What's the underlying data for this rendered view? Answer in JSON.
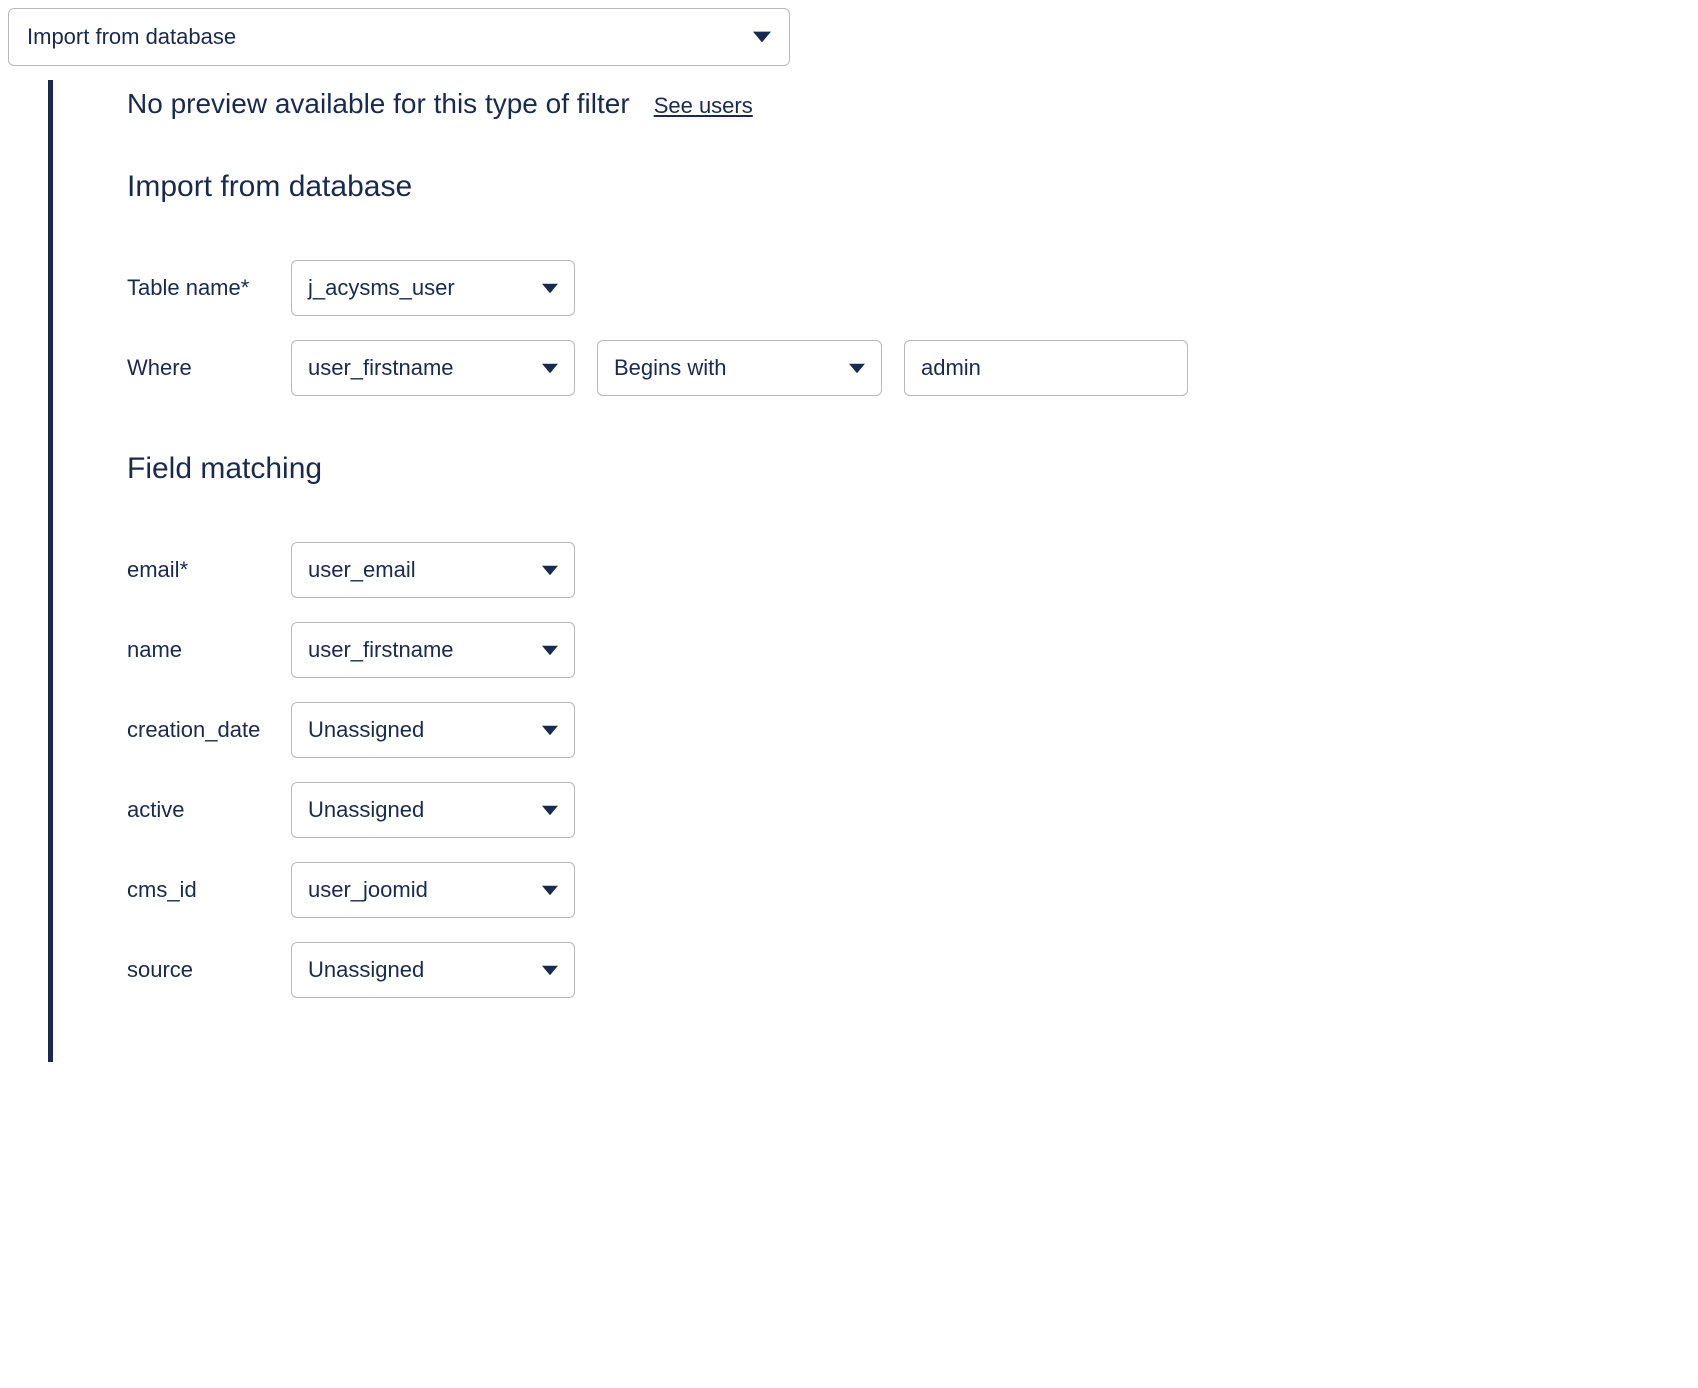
{
  "topSelect": {
    "value": "Import from database"
  },
  "preview": {
    "text": "No preview available for this type of filter",
    "link": "See users"
  },
  "sections": {
    "import": "Import from database",
    "matching": "Field matching"
  },
  "form": {
    "tableName": {
      "label": "Table name*",
      "value": "j_acysms_user"
    },
    "where": {
      "label": "Where",
      "field": "user_firstname",
      "operator": "Begins with",
      "value": "admin"
    }
  },
  "matching": [
    {
      "label": "email*",
      "value": "user_email"
    },
    {
      "label": "name",
      "value": "user_firstname"
    },
    {
      "label": "creation_date",
      "value": "Unassigned"
    },
    {
      "label": "active",
      "value": "Unassigned"
    },
    {
      "label": "cms_id",
      "value": "user_joomid"
    },
    {
      "label": "source",
      "value": "Unassigned"
    }
  ]
}
